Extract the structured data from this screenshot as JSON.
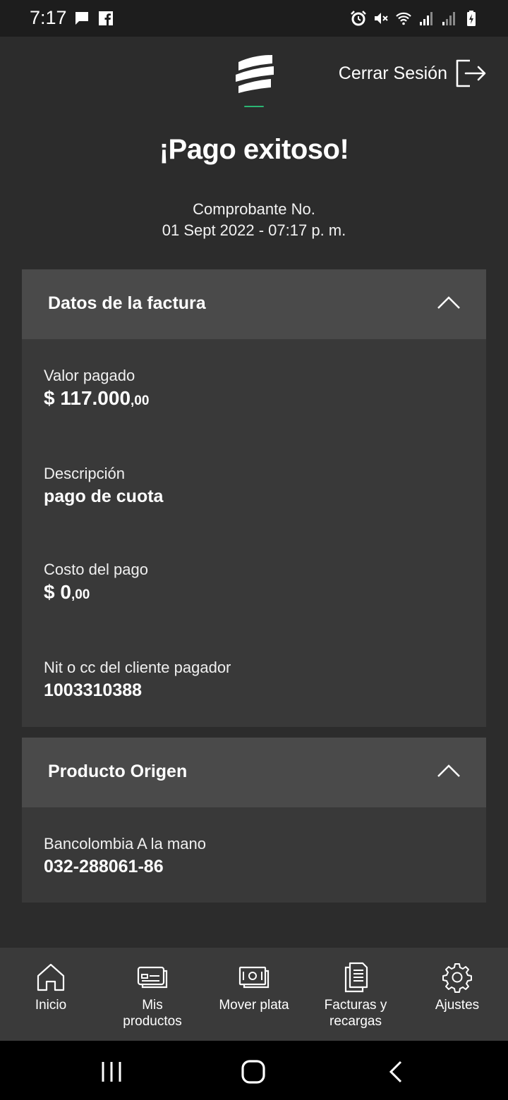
{
  "status_bar": {
    "time": "7:17",
    "left_icons": [
      "message-icon",
      "facebook-icon"
    ],
    "right_icons": [
      "alarm-icon",
      "mute-icon",
      "wifi-icon",
      "signal-icon",
      "signal-icon",
      "battery-icon"
    ]
  },
  "header": {
    "logout_label": "Cerrar Sesión",
    "logo": "bancolombia-logo"
  },
  "page": {
    "title": "¡Pago exitoso!",
    "receipt_label": "Comprobante No.",
    "receipt_datetime": "01 Sept 2022 - 07:17 p. m."
  },
  "invoice_section": {
    "header": "Datos de la factura",
    "paid_label": "Valor pagado",
    "paid_amount_main": "$ 117.000",
    "paid_amount_cents": ",00",
    "description_label": "Descripción",
    "description_value": "pago de cuota",
    "cost_label": "Costo del pago",
    "cost_main": "$ 0",
    "cost_cents": ",00",
    "client_id_label": "Nit o cc del cliente pagador",
    "client_id_value": "1003310388"
  },
  "origin_section": {
    "header": "Producto Origen",
    "account_label": "Bancolombia A la mano",
    "account_number": "032-288061-86"
  },
  "bottom_nav": {
    "items": [
      {
        "label": "Inicio",
        "icon": "home-icon"
      },
      {
        "label": "Mis\nproductos",
        "icon": "card-icon"
      },
      {
        "label": "Mover plata",
        "icon": "money-icon"
      },
      {
        "label": "Facturas y\nrecargas",
        "icon": "bill-icon"
      },
      {
        "label": "Ajustes",
        "icon": "gear-icon"
      }
    ]
  },
  "colors": {
    "background": "#2c2c2c",
    "card": "#393939",
    "card_header": "#4a4a4a",
    "nav": "#3a3a3a",
    "accent_green": "#2bb673"
  }
}
